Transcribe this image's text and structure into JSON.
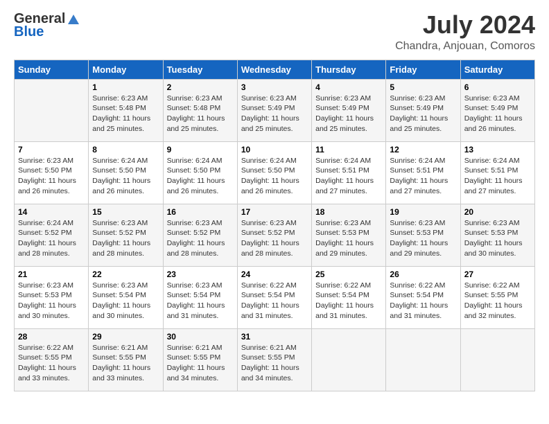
{
  "header": {
    "logo_line1": "General",
    "logo_line2": "Blue",
    "month": "July 2024",
    "location": "Chandra, Anjouan, Comoros"
  },
  "weekdays": [
    "Sunday",
    "Monday",
    "Tuesday",
    "Wednesday",
    "Thursday",
    "Friday",
    "Saturday"
  ],
  "weeks": [
    [
      {
        "day": "",
        "info": ""
      },
      {
        "day": "1",
        "info": "Sunrise: 6:23 AM\nSunset: 5:48 PM\nDaylight: 11 hours\nand 25 minutes."
      },
      {
        "day": "2",
        "info": "Sunrise: 6:23 AM\nSunset: 5:48 PM\nDaylight: 11 hours\nand 25 minutes."
      },
      {
        "day": "3",
        "info": "Sunrise: 6:23 AM\nSunset: 5:49 PM\nDaylight: 11 hours\nand 25 minutes."
      },
      {
        "day": "4",
        "info": "Sunrise: 6:23 AM\nSunset: 5:49 PM\nDaylight: 11 hours\nand 25 minutes."
      },
      {
        "day": "5",
        "info": "Sunrise: 6:23 AM\nSunset: 5:49 PM\nDaylight: 11 hours\nand 25 minutes."
      },
      {
        "day": "6",
        "info": "Sunrise: 6:23 AM\nSunset: 5:49 PM\nDaylight: 11 hours\nand 26 minutes."
      }
    ],
    [
      {
        "day": "7",
        "info": "Sunrise: 6:23 AM\nSunset: 5:50 PM\nDaylight: 11 hours\nand 26 minutes."
      },
      {
        "day": "8",
        "info": "Sunrise: 6:24 AM\nSunset: 5:50 PM\nDaylight: 11 hours\nand 26 minutes."
      },
      {
        "day": "9",
        "info": "Sunrise: 6:24 AM\nSunset: 5:50 PM\nDaylight: 11 hours\nand 26 minutes."
      },
      {
        "day": "10",
        "info": "Sunrise: 6:24 AM\nSunset: 5:50 PM\nDaylight: 11 hours\nand 26 minutes."
      },
      {
        "day": "11",
        "info": "Sunrise: 6:24 AM\nSunset: 5:51 PM\nDaylight: 11 hours\nand 27 minutes."
      },
      {
        "day": "12",
        "info": "Sunrise: 6:24 AM\nSunset: 5:51 PM\nDaylight: 11 hours\nand 27 minutes."
      },
      {
        "day": "13",
        "info": "Sunrise: 6:24 AM\nSunset: 5:51 PM\nDaylight: 11 hours\nand 27 minutes."
      }
    ],
    [
      {
        "day": "14",
        "info": "Sunrise: 6:24 AM\nSunset: 5:52 PM\nDaylight: 11 hours\nand 28 minutes."
      },
      {
        "day": "15",
        "info": "Sunrise: 6:23 AM\nSunset: 5:52 PM\nDaylight: 11 hours\nand 28 minutes."
      },
      {
        "day": "16",
        "info": "Sunrise: 6:23 AM\nSunset: 5:52 PM\nDaylight: 11 hours\nand 28 minutes."
      },
      {
        "day": "17",
        "info": "Sunrise: 6:23 AM\nSunset: 5:52 PM\nDaylight: 11 hours\nand 28 minutes."
      },
      {
        "day": "18",
        "info": "Sunrise: 6:23 AM\nSunset: 5:53 PM\nDaylight: 11 hours\nand 29 minutes."
      },
      {
        "day": "19",
        "info": "Sunrise: 6:23 AM\nSunset: 5:53 PM\nDaylight: 11 hours\nand 29 minutes."
      },
      {
        "day": "20",
        "info": "Sunrise: 6:23 AM\nSunset: 5:53 PM\nDaylight: 11 hours\nand 30 minutes."
      }
    ],
    [
      {
        "day": "21",
        "info": "Sunrise: 6:23 AM\nSunset: 5:53 PM\nDaylight: 11 hours\nand 30 minutes."
      },
      {
        "day": "22",
        "info": "Sunrise: 6:23 AM\nSunset: 5:54 PM\nDaylight: 11 hours\nand 30 minutes."
      },
      {
        "day": "23",
        "info": "Sunrise: 6:23 AM\nSunset: 5:54 PM\nDaylight: 11 hours\nand 31 minutes."
      },
      {
        "day": "24",
        "info": "Sunrise: 6:22 AM\nSunset: 5:54 PM\nDaylight: 11 hours\nand 31 minutes."
      },
      {
        "day": "25",
        "info": "Sunrise: 6:22 AM\nSunset: 5:54 PM\nDaylight: 11 hours\nand 31 minutes."
      },
      {
        "day": "26",
        "info": "Sunrise: 6:22 AM\nSunset: 5:54 PM\nDaylight: 11 hours\nand 31 minutes."
      },
      {
        "day": "27",
        "info": "Sunrise: 6:22 AM\nSunset: 5:55 PM\nDaylight: 11 hours\nand 32 minutes."
      }
    ],
    [
      {
        "day": "28",
        "info": "Sunrise: 6:22 AM\nSunset: 5:55 PM\nDaylight: 11 hours\nand 33 minutes."
      },
      {
        "day": "29",
        "info": "Sunrise: 6:21 AM\nSunset: 5:55 PM\nDaylight: 11 hours\nand 33 minutes."
      },
      {
        "day": "30",
        "info": "Sunrise: 6:21 AM\nSunset: 5:55 PM\nDaylight: 11 hours\nand 34 minutes."
      },
      {
        "day": "31",
        "info": "Sunrise: 6:21 AM\nSunset: 5:55 PM\nDaylight: 11 hours\nand 34 minutes."
      },
      {
        "day": "",
        "info": ""
      },
      {
        "day": "",
        "info": ""
      },
      {
        "day": "",
        "info": ""
      }
    ]
  ]
}
